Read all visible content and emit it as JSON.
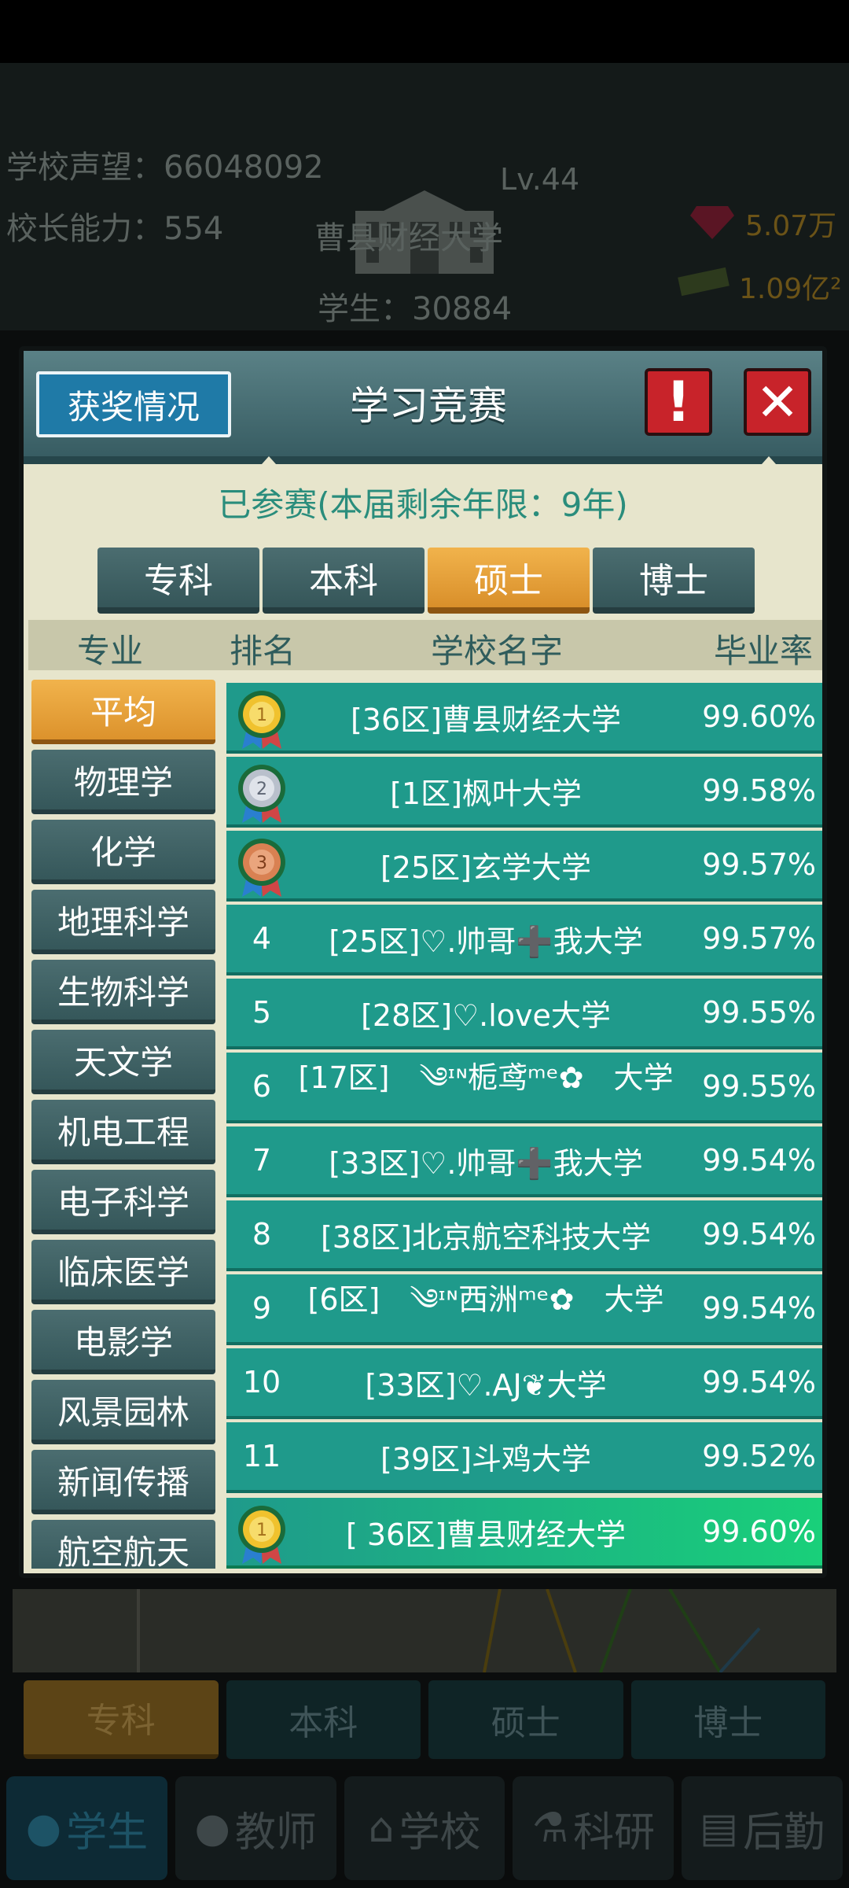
{
  "background": {
    "reputation": "学校声望：66048092",
    "ability": "校长能力：554",
    "level": "Lv.44",
    "school_name": "曹县财经大学",
    "students": "学生：30884",
    "gems": "5.07万",
    "cash": "1.09亿²",
    "level_tabs": [
      "专科",
      "本科",
      "硕士",
      "博士"
    ],
    "nav": [
      {
        "label": "学生",
        "icon": "student-icon"
      },
      {
        "label": "教师",
        "icon": "teacher-icon"
      },
      {
        "label": "学校",
        "icon": "school-icon"
      },
      {
        "label": "科研",
        "icon": "flask-icon"
      },
      {
        "label": "后勤",
        "icon": "clipboard-icon"
      }
    ]
  },
  "modal": {
    "awards_label": "获奖情况",
    "title": "学习竞赛",
    "info_icon_glyph": "!",
    "close_icon_glyph": "✕",
    "status": "已参赛(本届剩余年限：9年)",
    "level_tabs": [
      {
        "label": "专科",
        "active": false
      },
      {
        "label": "本科",
        "active": false
      },
      {
        "label": "硕士",
        "active": true
      },
      {
        "label": "博士",
        "active": false
      }
    ],
    "headers": {
      "major": "专业",
      "rank": "排名",
      "school": "学校名字",
      "rate": "毕业率"
    },
    "majors": [
      "平均",
      "物理学",
      "化学",
      "地理科学",
      "生物科学",
      "天文学",
      "机电工程",
      "电子科学",
      "临床医学",
      "电影学",
      "风景园林",
      "新闻传播",
      "航空航天"
    ],
    "active_major": "平均",
    "rows": [
      {
        "rank": "1",
        "medal": "gold",
        "school": "[36区]曹县财经大学",
        "rate": "99.60%"
      },
      {
        "rank": "2",
        "medal": "silver",
        "school": "[1区]枫叶大学",
        "rate": "99.58%"
      },
      {
        "rank": "3",
        "medal": "bronze",
        "school": "[25区]玄学大学",
        "rate": "99.57%"
      },
      {
        "rank": "4",
        "medal": "",
        "school": "[25区]♡.帅哥➕我大学",
        "rate": "99.57%"
      },
      {
        "rank": "5",
        "medal": "",
        "school": "[28区]♡.love大学",
        "rate": "99.55%"
      },
      {
        "rank": "6",
        "medal": "",
        "school": "[17区]　༄ᶦᶰ栀鸢ᵐᵉ✿　大学",
        "rate": "99.55%"
      },
      {
        "rank": "7",
        "medal": "",
        "school": "[33区]♡.帅哥➕我大学",
        "rate": "99.54%"
      },
      {
        "rank": "8",
        "medal": "",
        "school": "[38区]北京航空科技大学",
        "rate": "99.54%"
      },
      {
        "rank": "9",
        "medal": "",
        "school": "[6区]　༄ᶦᶰ西洲ᵐᵉ✿　大学",
        "rate": "99.54%"
      },
      {
        "rank": "10",
        "medal": "",
        "school": "[33区]♡.AJ❦大学",
        "rate": "99.54%"
      },
      {
        "rank": "11",
        "medal": "",
        "school": "[39区]斗鸡大学",
        "rate": "99.52%"
      }
    ],
    "my_row": {
      "rank": "1",
      "medal": "gold",
      "school": "[ 36区]曹县财经大学",
      "rate": "99.60%"
    }
  },
  "colors": {
    "row": "#1f9a8b",
    "active_tab": "#e8a43d",
    "danger": "#c8232a",
    "accent_text": "#2a8d7c"
  }
}
